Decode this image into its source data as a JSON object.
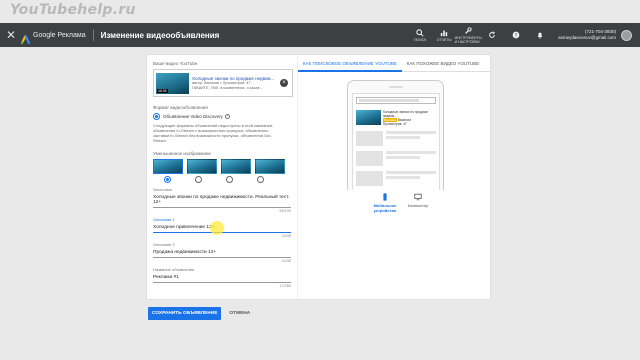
{
  "watermark": "YouTubehelp.ru",
  "header": {
    "close_icon": "close-icon",
    "brand": "Google Реклама",
    "title": "Изменение видеообъявления",
    "tools": [
      {
        "icon": "search-icon",
        "label": "ПОИСК"
      },
      {
        "icon": "reports-icon",
        "label": "ОТЧЕТЫ"
      },
      {
        "icon": "wrench-icon",
        "label": "ИНСТРУМЕНТЫ И НАСТРОЙКИ"
      },
      {
        "icon": "refresh-icon",
        "label": ""
      },
      {
        "icon": "help-icon",
        "label": ""
      },
      {
        "icon": "bell-icon",
        "label": ""
      }
    ],
    "account_id": "(721-704-3930)",
    "account_email": "asmeydaevonov@gmail.com"
  },
  "form": {
    "video_label": "Ваше видео YouTube",
    "video": {
      "duration": "46:55",
      "title": "Холодные звонки по продаже недвиж...",
      "meta1": "автор: Василии • Просмотров: 47",
      "meta2": "ПИШИТЕ, ГМЛ, в комментиях, я касае..."
    },
    "format_label": "Формат видеообъявления",
    "format_option": "Объявление Video Discovery",
    "format_desc": "Следующие форматы объявлений недоступны в этой кампании: объявления In-Stream с возможностью пропуска, объявления-заставки In-Stream без возможности пропуска, объявления Out-Stream",
    "thumbs_label": "Уменьшенное изображение",
    "fields": [
      {
        "label": "Заголовок",
        "value": "Холодные звонки по продаже недвижимости. Реальный тест. 12+",
        "counter": "59/100"
      },
      {
        "label": "Описание 1",
        "value": "Холодное привлечение 12+",
        "counter": "24/35"
      },
      {
        "label": "Описание 2",
        "value": "Продажа недвижимости 12+",
        "counter": "24/35"
      },
      {
        "label": "Название объявления",
        "value": "Реклама #1",
        "counter": "17/255"
      }
    ]
  },
  "preview": {
    "tabs": [
      "КАК ПОИСКОВОЕ ОБЪЯВЛЕНИЕ YOUTUBE",
      "КАК ПОХОЖЕЕ ВИДЕО YOUTUBE"
    ],
    "ad_title": "Холодные звонки по продаже недвиж...",
    "ad_badge": "Реклама",
    "ad_author": "Василии",
    "ad_views": "Просмотров: 47",
    "devices": [
      {
        "icon": "phone-icon",
        "label": "Мобильное устройство"
      },
      {
        "icon": "desktop-icon",
        "label": "Компьютер"
      }
    ]
  },
  "actions": {
    "save": "СОХРАНИТЬ ОБЪЯВЛЕНИЕ",
    "cancel": "ОТМЕНА"
  }
}
